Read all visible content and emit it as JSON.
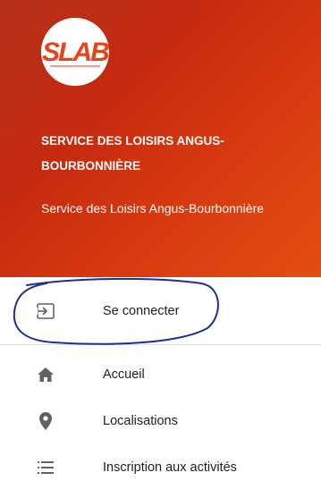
{
  "header": {
    "logo_text": "SLAB",
    "title": "SERVICE DES LOISIRS ANGUS-BOURBONNIÈRE",
    "subtitle": "Service des Loisirs Angus-Bourbonnière"
  },
  "menu": {
    "items": [
      {
        "label": "Se connecter",
        "icon": "login-icon"
      },
      {
        "label": "Accueil",
        "icon": "home-icon"
      },
      {
        "label": "Localisations",
        "icon": "location-pin-icon"
      },
      {
        "label": "Inscription aux activités",
        "icon": "list-icon"
      }
    ]
  },
  "colors": {
    "header_start": "#b3301a",
    "header_end": "#e24e12",
    "icon_gray": "#5f6368",
    "annotation_blue": "#1d2f9a"
  }
}
